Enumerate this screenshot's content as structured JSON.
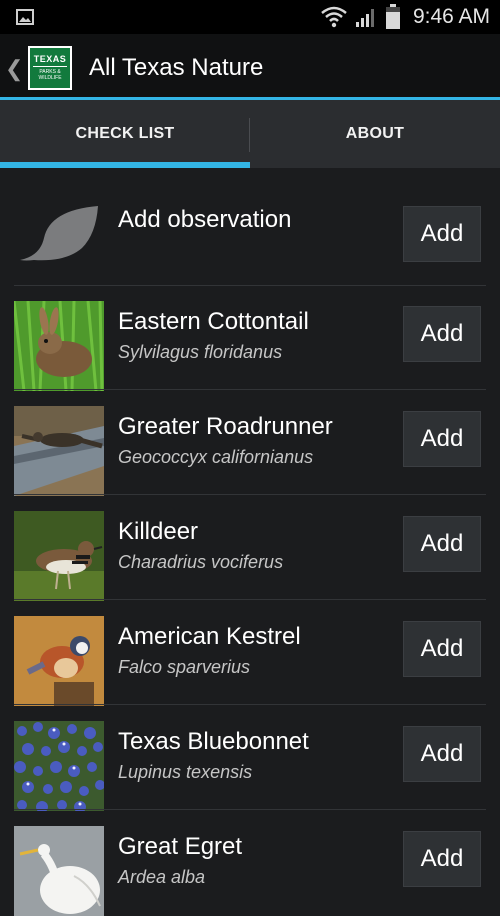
{
  "status_bar": {
    "time": "9:46 AM",
    "icons": [
      "gallery-icon",
      "wifi-icon",
      "signal-icon",
      "battery-icon"
    ]
  },
  "action_bar": {
    "up_icon": "chevron-left-icon",
    "logo_text": [
      "TEXAS",
      "PARKS &",
      "WILDLIFE"
    ],
    "title": "All Texas Nature",
    "accent_color": "#33b5e5",
    "logo_color": "#127a3d"
  },
  "tabs": [
    {
      "label": "CHECK LIST",
      "active": true
    },
    {
      "label": "ABOUT",
      "active": false
    }
  ],
  "list": {
    "add_observation_label": "Add observation",
    "add_label": "Add",
    "items": [
      {
        "common": "Eastern Cottontail",
        "scientific": "Sylvilagus floridanus",
        "thumb": "rabbit-photo"
      },
      {
        "common": "Greater Roadrunner",
        "scientific": "Geococcyx californianus",
        "thumb": "roadrunner-photo"
      },
      {
        "common": "Killdeer",
        "scientific": "Charadrius vociferus",
        "thumb": "killdeer-photo"
      },
      {
        "common": "American Kestrel",
        "scientific": "Falco sparverius",
        "thumb": "kestrel-photo"
      },
      {
        "common": "Texas Bluebonnet",
        "scientific": "Lupinus texensis",
        "thumb": "bluebonnet-photo"
      },
      {
        "common": "Great Egret",
        "scientific": "Ardea alba",
        "thumb": "egret-photo"
      }
    ]
  }
}
